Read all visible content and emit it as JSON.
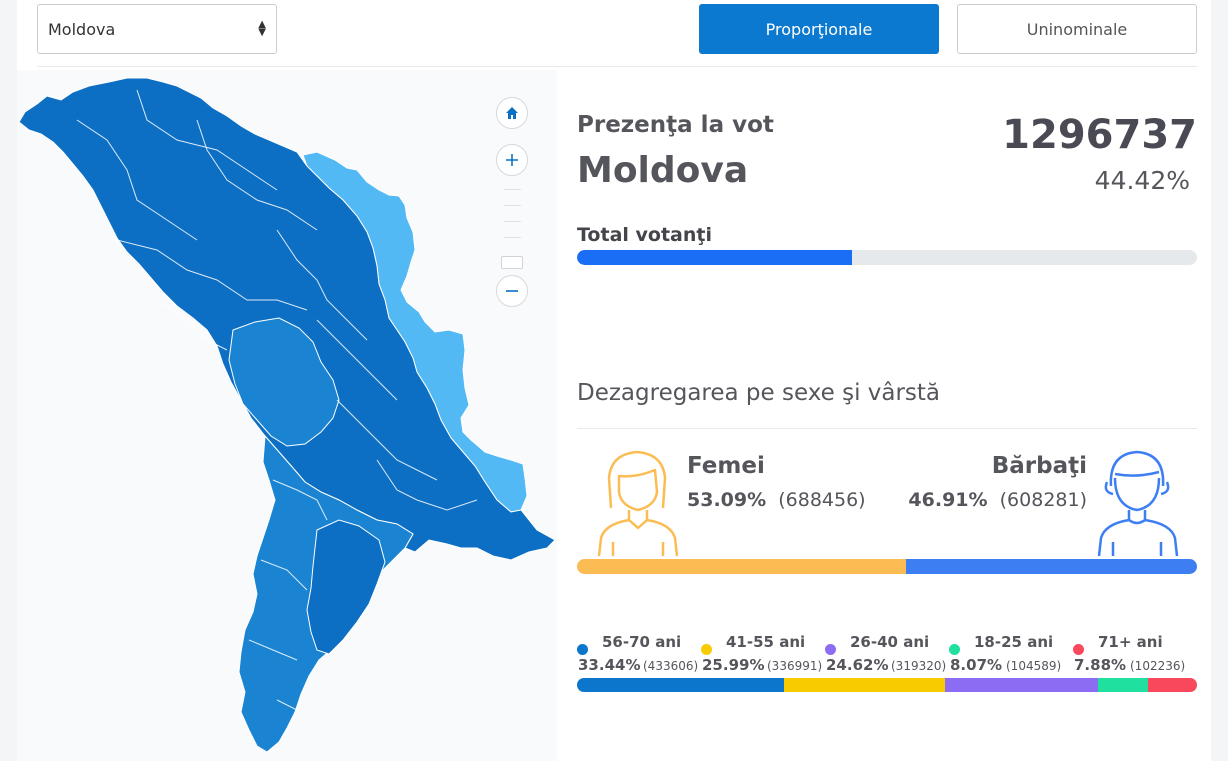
{
  "controls": {
    "region_select_value": "Moldova",
    "btn_proportional": "Proporţionale",
    "btn_uninominal": "Uninominale"
  },
  "stats": {
    "presence_label": "Prezenţa la vot",
    "region": "Moldova",
    "total": "1296737",
    "percent": "44.42%",
    "voters_label": "Total votanţi",
    "voters_fraction": 0.4442
  },
  "breakdown": {
    "title": "Dezagregarea pe sexe şi vârstă",
    "female": {
      "label": "Femei",
      "percent": "53.09%",
      "count": "(688456)",
      "color": "#fbbd53",
      "share": 0.5309
    },
    "male": {
      "label": "Bărbaţi",
      "percent": "46.91%",
      "count": "(608281)",
      "color": "#3d7ff3",
      "share": 0.4691
    }
  },
  "age_groups": [
    {
      "label": "56-70 ani",
      "percent": "33.44%",
      "count": "(433606)",
      "color": "#0b76cc",
      "share": 0.3344
    },
    {
      "label": "41-55 ani",
      "percent": "25.99%",
      "count": "(336991)",
      "color": "#f7cb00",
      "share": 0.2599
    },
    {
      "label": "26-40 ani",
      "percent": "24.62%",
      "count": "(319320)",
      "color": "#8b6cf2",
      "share": 0.2462
    },
    {
      "label": "18-25 ani",
      "percent": "8.07%",
      "count": "(104589)",
      "color": "#1fe09f",
      "share": 0.0807
    },
    {
      "label": "71+ ani",
      "percent": "7.88%",
      "count": "(102236)",
      "color": "#f9475b",
      "share": 0.0788
    }
  ],
  "map": {
    "zoom_controls": [
      "home-icon",
      "plus-icon",
      "minus-icon"
    ],
    "colors": {
      "dark": "#0c6fc4",
      "medium": "#1a84d2",
      "light": "#52b9f5"
    }
  }
}
